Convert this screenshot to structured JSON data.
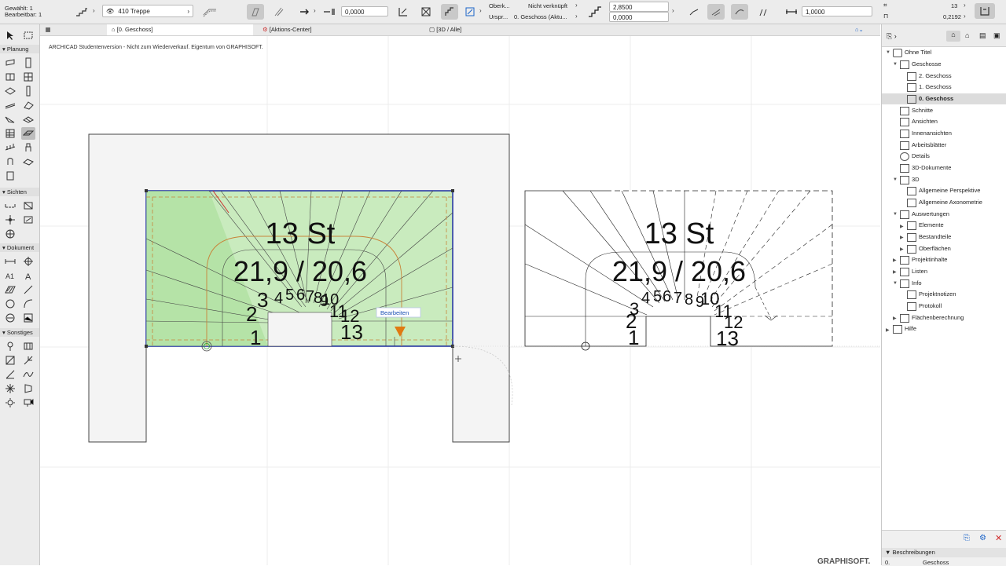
{
  "toolbar": {
    "selected_label": "Gewählt: 1",
    "editable_label": "Bearbeitbar: 1",
    "layer_name": "410 Treppe",
    "offset_value": "0,0000",
    "top_link_label": "Oberk...",
    "top_link_value": "Nicht verknüpft",
    "origin_label": "Urspr...",
    "origin_value": "0. Geschoss (Aktu...",
    "height_value": "2,8500",
    "elevation_value": "0,0000",
    "scale_value": "1,0000",
    "riser_count": "13",
    "riser_height": "0,2192"
  },
  "tabs": [
    {
      "label": "[0. Geschoss]",
      "icon": "floorplan-icon"
    },
    {
      "label": "[Aktions-Center]",
      "icon": "action-center-icon"
    },
    {
      "label": "[3D / Alle]",
      "icon": "3d-window-icon"
    }
  ],
  "toolbox": {
    "sections": [
      "Planung",
      "Sichten",
      "Dokument",
      "Sonstiges"
    ]
  },
  "canvas": {
    "watermark": "ARCHICAD Studentenversion - Nicht zum Wiederverkauf. Eigentum von GRAPHISOFT.",
    "stair_count_label": "13 St",
    "stair_ratio_label": "21,9 / 20,6",
    "step_labels": [
      "1",
      "2",
      "3",
      "4",
      "5",
      "6",
      "7",
      "8",
      "9",
      "10",
      "11",
      "12",
      "13"
    ],
    "edit_popup": "Bearbeiten",
    "brand": "GRAPHISOFT."
  },
  "navigator": {
    "items": [
      {
        "label": "Ohne Titel",
        "level": 0,
        "icon": "project-icon"
      },
      {
        "label": "Geschosse",
        "level": 1,
        "icon": "stories-icon"
      },
      {
        "label": "2. Geschoss",
        "level": 2,
        "icon": "story-icon"
      },
      {
        "label": "1. Geschoss",
        "level": 2,
        "icon": "story-icon"
      },
      {
        "label": "0. Geschoss",
        "level": 2,
        "icon": "story-icon",
        "selected": true
      },
      {
        "label": "Schnitte",
        "level": 1,
        "icon": "section-icon"
      },
      {
        "label": "Ansichten",
        "level": 1,
        "icon": "elevation-icon"
      },
      {
        "label": "Innenansichten",
        "level": 1,
        "icon": "interior-elevation-icon"
      },
      {
        "label": "Arbeitsblätter",
        "level": 1,
        "icon": "worksheet-icon"
      },
      {
        "label": "Details",
        "level": 1,
        "icon": "detail-icon"
      },
      {
        "label": "3D-Dokumente",
        "level": 1,
        "icon": "3d-document-icon"
      },
      {
        "label": "3D",
        "level": 1,
        "icon": "3d-icon"
      },
      {
        "label": "Allgemeine Perspektive",
        "level": 2,
        "icon": "perspective-icon"
      },
      {
        "label": "Allgemeine Axonometrie",
        "level": 2,
        "icon": "axonometry-icon"
      },
      {
        "label": "Auswertungen",
        "level": 1,
        "icon": "schedule-icon"
      },
      {
        "label": "Elemente",
        "level": 2,
        "icon": "elements-icon"
      },
      {
        "label": "Bestandteile",
        "level": 2,
        "icon": "components-icon"
      },
      {
        "label": "Oberflächen",
        "level": 2,
        "icon": "surfaces-icon"
      },
      {
        "label": "Projektinhalte",
        "level": 1,
        "icon": "project-index-icon"
      },
      {
        "label": "Listen",
        "level": 1,
        "icon": "lists-icon"
      },
      {
        "label": "Info",
        "level": 1,
        "icon": "info-icon"
      },
      {
        "label": "Projektnotizen",
        "level": 2,
        "icon": "notes-icon"
      },
      {
        "label": "Protokoll",
        "level": 2,
        "icon": "report-icon"
      },
      {
        "label": "Flächenberechnung",
        "level": 1,
        "icon": "area-icon"
      },
      {
        "label": "Hilfe",
        "level": 0,
        "icon": "help-icon"
      }
    ],
    "descriptions_label": "Beschreibungen",
    "desc_col1": "0.",
    "desc_col2": "Geschoss"
  }
}
